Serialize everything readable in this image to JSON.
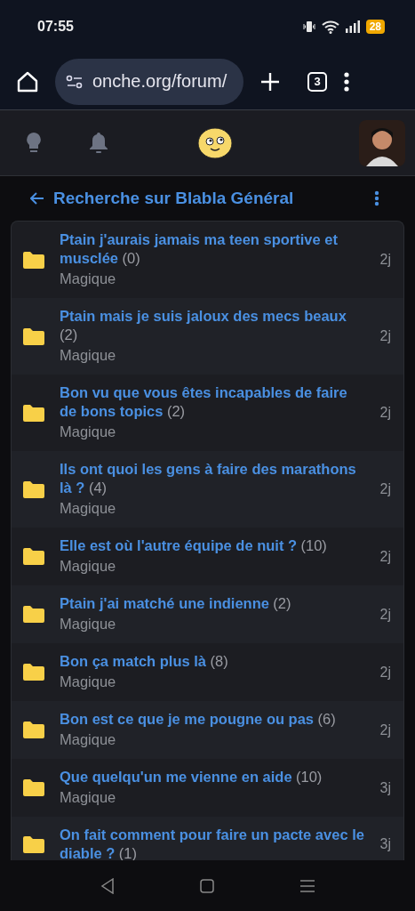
{
  "status_bar": {
    "time": "07:55",
    "battery": "28"
  },
  "browser": {
    "url": "onche.org/forum/",
    "tab_count": "3"
  },
  "page_header": {
    "title": "Recherche sur Blabla Général"
  },
  "topics": [
    {
      "title": "Ptain j'aurais jamais ma teen sportive et musclée",
      "count": "(0)",
      "author": "Magique",
      "age": "2j"
    },
    {
      "title": "Ptain mais je suis jaloux des mecs beaux",
      "count": "(2)",
      "author": "Magique",
      "age": "2j"
    },
    {
      "title": "Bon vu que vous êtes incapables de faire de bons topics",
      "count": "(2)",
      "author": "Magique",
      "age": "2j"
    },
    {
      "title": "Ils ont quoi les gens à faire des marathons là ?",
      "count": "(4)",
      "author": "Magique",
      "age": "2j"
    },
    {
      "title": "Elle est où l'autre équipe de nuit ?",
      "count": "(10)",
      "author": "Magique",
      "age": "2j"
    },
    {
      "title": "Ptain j'ai matché une indienne",
      "count": "(2)",
      "author": "Magique",
      "age": "2j"
    },
    {
      "title": "Bon ça match plus là",
      "count": "(8)",
      "author": "Magique",
      "age": "2j"
    },
    {
      "title": "Bon est ce que je me pougne ou pas",
      "count": "(6)",
      "author": "Magique",
      "age": "2j"
    },
    {
      "title": "Que quelqu'un me vienne en aide",
      "count": "(10)",
      "author": "Magique",
      "age": "3j"
    },
    {
      "title": "On fait comment pour faire un pacte avec le diable ?",
      "count": "(1)",
      "age": "3j"
    }
  ]
}
